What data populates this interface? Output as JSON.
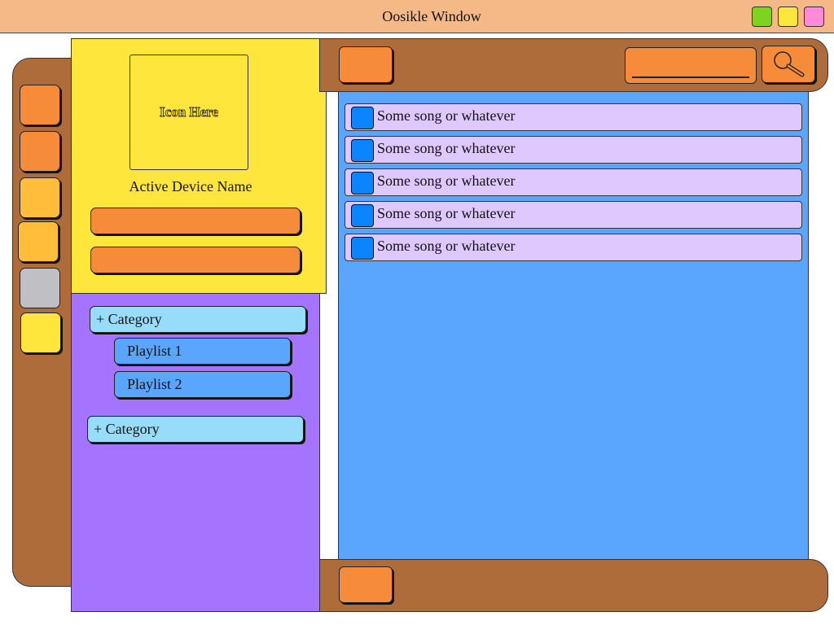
{
  "window": {
    "title": "Oosikle Window",
    "controls": [
      {
        "name": "green",
        "color": "#7ed321"
      },
      {
        "name": "yellow",
        "color": "#ffe63c"
      },
      {
        "name": "pink",
        "color": "#ff8ad8"
      }
    ]
  },
  "rail": {
    "colors": [
      "#f68c3a",
      "#f68c3a",
      "#ffbd3a",
      "#ffbd3a",
      "#c0c0c4",
      "#ffe63c"
    ]
  },
  "device": {
    "icon_text": "Icon Here",
    "name": "Active Device Name"
  },
  "sidebar": {
    "categories": [
      {
        "label": "+ Category",
        "playlists": [
          "Playlist 1",
          "Playlist 2"
        ]
      },
      {
        "label": "+ Category",
        "playlists": []
      }
    ]
  },
  "songs": [
    "Some song or whatever",
    "Some song or whatever",
    "Some song or whatever",
    "Some song or whatever",
    "Some song or whatever"
  ],
  "icons": {
    "search": "magnifier-icon"
  },
  "colors": {
    "title_bar": "#f5b987",
    "frame": "#ad6c3a",
    "button": "#f68c3a",
    "device_panel": "#ffe63c",
    "playlist_panel": "#a574fe",
    "song_panel": "#5aa6ff",
    "song_row": "#dfc8fd"
  }
}
